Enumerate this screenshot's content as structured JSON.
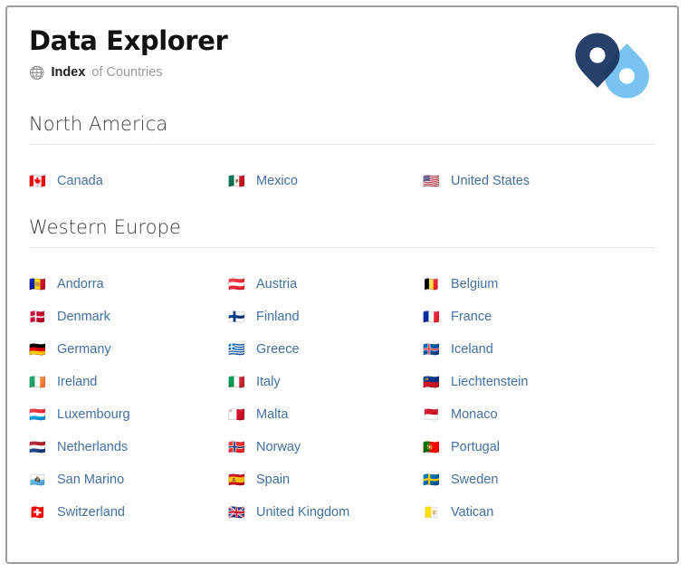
{
  "header": {
    "title": "Data Explorer",
    "subtitle_icon": "globe-with-meridians-icon",
    "subtitle_icon_glyph": "🌐",
    "subtitle_strong": "Index",
    "subtitle_muted": "of Countries",
    "logo": {
      "name": "map-pin-duo-logo",
      "dark_color": "#15325e",
      "light_color": "#7ac3f0"
    }
  },
  "theme": {
    "link_color": "#44709f",
    "heading_color": "#3a3a3a",
    "rule_color": "#e4e4e4",
    "border_color": "#9d9d9d",
    "background": "#ffffff"
  },
  "sections": [
    {
      "heading": "North America",
      "countries": [
        {
          "name": "Canada",
          "flag": "🇨🇦"
        },
        {
          "name": "Mexico",
          "flag": "🇲🇽"
        },
        {
          "name": "United States",
          "flag": "🇺🇸"
        }
      ]
    },
    {
      "heading": "Western Europe",
      "countries": [
        {
          "name": "Andorra",
          "flag": "🇦🇩"
        },
        {
          "name": "Austria",
          "flag": "🇦🇹"
        },
        {
          "name": "Belgium",
          "flag": "🇧🇪"
        },
        {
          "name": "Denmark",
          "flag": "🇩🇰"
        },
        {
          "name": "Finland",
          "flag": "🇫🇮"
        },
        {
          "name": "France",
          "flag": "🇫🇷"
        },
        {
          "name": "Germany",
          "flag": "🇩🇪"
        },
        {
          "name": "Greece",
          "flag": "🇬🇷"
        },
        {
          "name": "Iceland",
          "flag": "🇮🇸"
        },
        {
          "name": "Ireland",
          "flag": "🇮🇪"
        },
        {
          "name": "Italy",
          "flag": "🇮🇹"
        },
        {
          "name": "Liechtenstein",
          "flag": "🇱🇮"
        },
        {
          "name": "Luxembourg",
          "flag": "🇱🇺"
        },
        {
          "name": "Malta",
          "flag": "🇲🇹"
        },
        {
          "name": "Monaco",
          "flag": "🇲🇨"
        },
        {
          "name": "Netherlands",
          "flag": "🇳🇱"
        },
        {
          "name": "Norway",
          "flag": "🇳🇴"
        },
        {
          "name": "Portugal",
          "flag": "🇵🇹"
        },
        {
          "name": "San Marino",
          "flag": "🇸🇲"
        },
        {
          "name": "Spain",
          "flag": "🇪🇸"
        },
        {
          "name": "Sweden",
          "flag": "🇸🇪"
        },
        {
          "name": "Switzerland",
          "flag": "🇨🇭"
        },
        {
          "name": "United Kingdom",
          "flag": "🇬🇧"
        },
        {
          "name": "Vatican",
          "flag": "🇻🇦"
        }
      ]
    }
  ]
}
